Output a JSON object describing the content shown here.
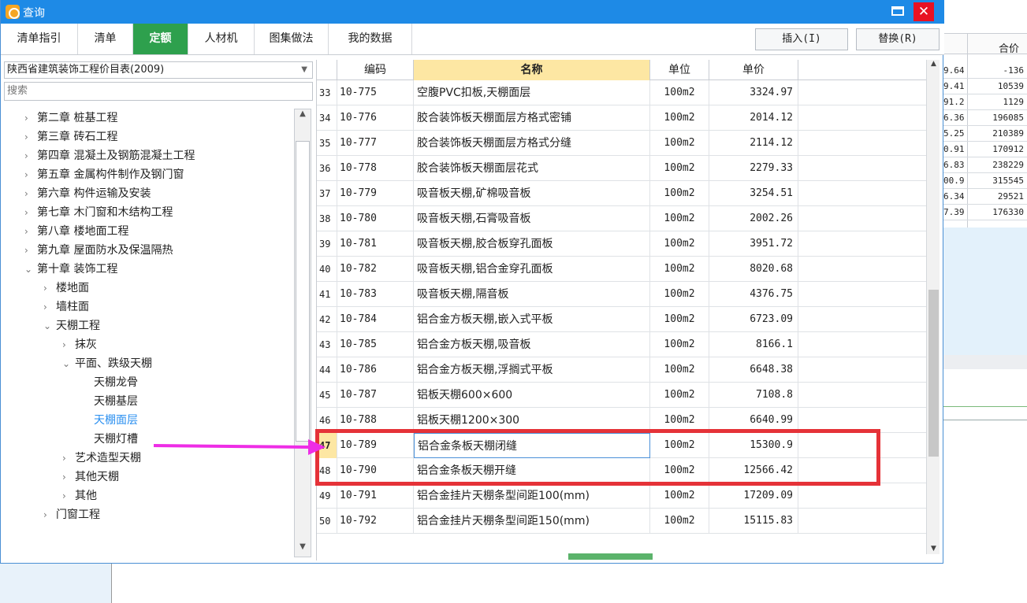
{
  "dialog": {
    "title": "查询",
    "tabs": [
      {
        "label": "清单指引"
      },
      {
        "label": "清单"
      },
      {
        "label": "定额"
      },
      {
        "label": "人材机"
      },
      {
        "label": "图集做法"
      },
      {
        "label": "我的数据"
      }
    ],
    "active_tab": "定额",
    "buttons": {
      "insert": "插入(I)",
      "replace": "替换(R)"
    }
  },
  "left_panel": {
    "dropdown_value": "陕西省建筑装饰工程价目表(2009)",
    "search_placeholder": "搜索",
    "tree": [
      {
        "label": "第二章 桩基工程",
        "level": 0,
        "state": "collapsed"
      },
      {
        "label": "第三章 砖石工程",
        "level": 0,
        "state": "collapsed"
      },
      {
        "label": "第四章 混凝土及钢筋混凝土工程",
        "level": 0,
        "state": "collapsed"
      },
      {
        "label": "第五章 金属构件制作及钢门窗",
        "level": 0,
        "state": "collapsed"
      },
      {
        "label": "第六章 构件运输及安装",
        "level": 0,
        "state": "collapsed"
      },
      {
        "label": "第七章 木门窗和木结构工程",
        "level": 0,
        "state": "collapsed"
      },
      {
        "label": "第八章 楼地面工程",
        "level": 0,
        "state": "collapsed"
      },
      {
        "label": "第九章 屋面防水及保温隔热",
        "level": 0,
        "state": "collapsed"
      },
      {
        "label": "第十章 装饰工程",
        "level": 0,
        "state": "expanded"
      },
      {
        "label": "楼地面",
        "level": 1,
        "state": "collapsed"
      },
      {
        "label": "墙柱面",
        "level": 1,
        "state": "collapsed"
      },
      {
        "label": "天棚工程",
        "level": 1,
        "state": "expanded"
      },
      {
        "label": "抹灰",
        "level": 2,
        "state": "collapsed"
      },
      {
        "label": "平面、跌级天棚",
        "level": 2,
        "state": "expanded"
      },
      {
        "label": "天棚龙骨",
        "level": 3,
        "state": "leaf"
      },
      {
        "label": "天棚基层",
        "level": 3,
        "state": "leaf"
      },
      {
        "label": "天棚面层",
        "level": 3,
        "state": "selected"
      },
      {
        "label": "天棚灯槽",
        "level": 3,
        "state": "leaf"
      },
      {
        "label": "艺术造型天棚",
        "level": 2,
        "state": "collapsed"
      },
      {
        "label": "其他天棚",
        "level": 2,
        "state": "collapsed"
      },
      {
        "label": "其他",
        "level": 2,
        "state": "collapsed"
      },
      {
        "label": "门窗工程",
        "level": 1,
        "state": "collapsed"
      }
    ]
  },
  "table": {
    "headers": {
      "code": "编码",
      "name": "名称",
      "unit": "单位",
      "price": "单价"
    },
    "rows": [
      {
        "idx": "33",
        "code": "10-775",
        "name": "空腹PVC扣板,天棚面层",
        "unit": "100m2",
        "price": "3324.97"
      },
      {
        "idx": "34",
        "code": "10-776",
        "name": "胶合装饰板天棚面层方格式密铺",
        "unit": "100m2",
        "price": "2014.12"
      },
      {
        "idx": "35",
        "code": "10-777",
        "name": "胶合装饰板天棚面层方格式分缝",
        "unit": "100m2",
        "price": "2114.12"
      },
      {
        "idx": "36",
        "code": "10-778",
        "name": "胶合装饰板天棚面层花式",
        "unit": "100m2",
        "price": "2279.33"
      },
      {
        "idx": "37",
        "code": "10-779",
        "name": "吸音板天棚,矿棉吸音板",
        "unit": "100m2",
        "price": "3254.51"
      },
      {
        "idx": "38",
        "code": "10-780",
        "name": "吸音板天棚,石膏吸音板",
        "unit": "100m2",
        "price": "2002.26"
      },
      {
        "idx": "39",
        "code": "10-781",
        "name": "吸音板天棚,胶合板穿孔面板",
        "unit": "100m2",
        "price": "3951.72"
      },
      {
        "idx": "40",
        "code": "10-782",
        "name": "吸音板天棚,铝合金穿孔面板",
        "unit": "100m2",
        "price": "8020.68"
      },
      {
        "idx": "41",
        "code": "10-783",
        "name": "吸音板天棚,隔音板",
        "unit": "100m2",
        "price": "4376.75"
      },
      {
        "idx": "42",
        "code": "10-784",
        "name": "铝合金方板天棚,嵌入式平板",
        "unit": "100m2",
        "price": "6723.09"
      },
      {
        "idx": "43",
        "code": "10-785",
        "name": "铝合金方板天棚,吸音板",
        "unit": "100m2",
        "price": "8166.1"
      },
      {
        "idx": "44",
        "code": "10-786",
        "name": "铝合金方板天棚,浮搁式平板",
        "unit": "100m2",
        "price": "6648.38"
      },
      {
        "idx": "45",
        "code": "10-787",
        "name": "铝板天棚600×600",
        "unit": "100m2",
        "price": "7108.8"
      },
      {
        "idx": "46",
        "code": "10-788",
        "name": "铝板天棚1200×300",
        "unit": "100m2",
        "price": "6640.99"
      },
      {
        "idx": "47",
        "code": "10-789",
        "name": "铝合金条板天棚闭缝",
        "unit": "100m2",
        "price": "15300.9"
      },
      {
        "idx": "48",
        "code": "10-790",
        "name": "铝合金条板天棚开缝",
        "unit": "100m2",
        "price": "12566.42"
      },
      {
        "idx": "49",
        "code": "10-791",
        "name": "铝合金挂片天棚条型间距100(mm)",
        "unit": "100m2",
        "price": "17209.09"
      },
      {
        "idx": "50",
        "code": "10-792",
        "name": "铝合金挂片天棚条型间距150(mm)",
        "unit": "100m2",
        "price": "15115.83"
      }
    ],
    "selected_row": "47"
  },
  "background": {
    "header": "合价",
    "rows": [
      {
        "a": "9.64",
        "b": "-136"
      },
      {
        "a": "9.41",
        "b": "10539"
      },
      {
        "a": "91.2",
        "b": "1129"
      },
      {
        "a": "6.36",
        "b": "196085"
      },
      {
        "a": "5.25",
        "b": "210389"
      },
      {
        "a": "0.91",
        "b": "170912"
      },
      {
        "a": "6.83",
        "b": "238229"
      },
      {
        "a": "00.9",
        "b": "315545"
      },
      {
        "a": "6.34",
        "b": "29521"
      },
      {
        "a": "7.39",
        "b": "176330"
      }
    ]
  },
  "colors": {
    "title_bar": "#1e8ae6",
    "active_tab": "#2ea04d",
    "highlight_box": "#e53238",
    "arrow": "#ee2de6",
    "selected_tree": "#2a8ff0"
  }
}
